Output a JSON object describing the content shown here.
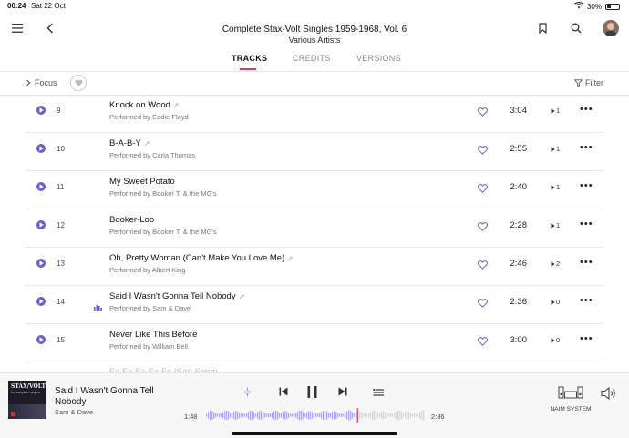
{
  "status": {
    "time": "00:24",
    "date": "Sat 22 Oct",
    "battery": "30%",
    "battery_level": 0.3
  },
  "header": {
    "album_title": "Complete Stax-Volt Singles 1959-1968, Vol. 6",
    "artist": "Various Artists",
    "menu_icon": "hamburger-icon",
    "back_icon": "chevron-left-icon",
    "bookmark_icon": "bookmark-icon",
    "search_icon": "search-icon",
    "avatar_icon": "user-avatar",
    "tabs": [
      {
        "label": "TRACKS",
        "active": true
      },
      {
        "label": "CREDITS",
        "active": false
      },
      {
        "label": "VERSIONS",
        "active": false
      }
    ]
  },
  "toolbar": {
    "focus_label": "Focus",
    "filter_label": "Filter"
  },
  "tracks": [
    {
      "number": "9",
      "title": "Knock on Wood",
      "performer": "Performed by Eddie Floyd",
      "duration": "3:04",
      "plays": "1",
      "has_link": true,
      "playing": false
    },
    {
      "number": "10",
      "title": "B-A-B-Y",
      "performer": "Performed by Carla Thomas",
      "duration": "2:55",
      "plays": "1",
      "has_link": true,
      "playing": false
    },
    {
      "number": "11",
      "title": "My Sweet Potato",
      "performer": "Performed by Booker T. & the MG's",
      "duration": "2:40",
      "plays": "1",
      "has_link": false,
      "playing": false
    },
    {
      "number": "12",
      "title": "Booker-Loo",
      "performer": "Performed by Booker T. & the MG's",
      "duration": "2:28",
      "plays": "1",
      "has_link": false,
      "playing": false
    },
    {
      "number": "13",
      "title": "Oh, Pretty Woman (Can't Make You Love Me)",
      "performer": "Performed by Albert King",
      "duration": "2:46",
      "plays": "2",
      "has_link": true,
      "playing": false
    },
    {
      "number": "14",
      "title": "Said I Wasn't Gonna Tell Nobody",
      "performer": "Performed by Sam & Dave",
      "duration": "2:36",
      "plays": "0",
      "has_link": true,
      "playing": true
    },
    {
      "number": "15",
      "title": "Never Like This Before",
      "performer": "Performed by William Bell",
      "duration": "3:00",
      "plays": "0",
      "has_link": false,
      "playing": false
    }
  ],
  "partial_track_title": "Fa-Fa-Fa-Fa-Fa (Sad Song)",
  "player": {
    "album_art_text": "STAX/VOLT",
    "album_art_sub": "the complete singles",
    "title": "Said I Wasn't Gonna Tell Nobody",
    "artist": "Sam & Dave",
    "elapsed": "1:48",
    "total": "2:36",
    "progress": 0.69,
    "device_label": "NAIM SYSTEM",
    "accent": "#6b5fc7",
    "progress_color": "#e8344a"
  }
}
